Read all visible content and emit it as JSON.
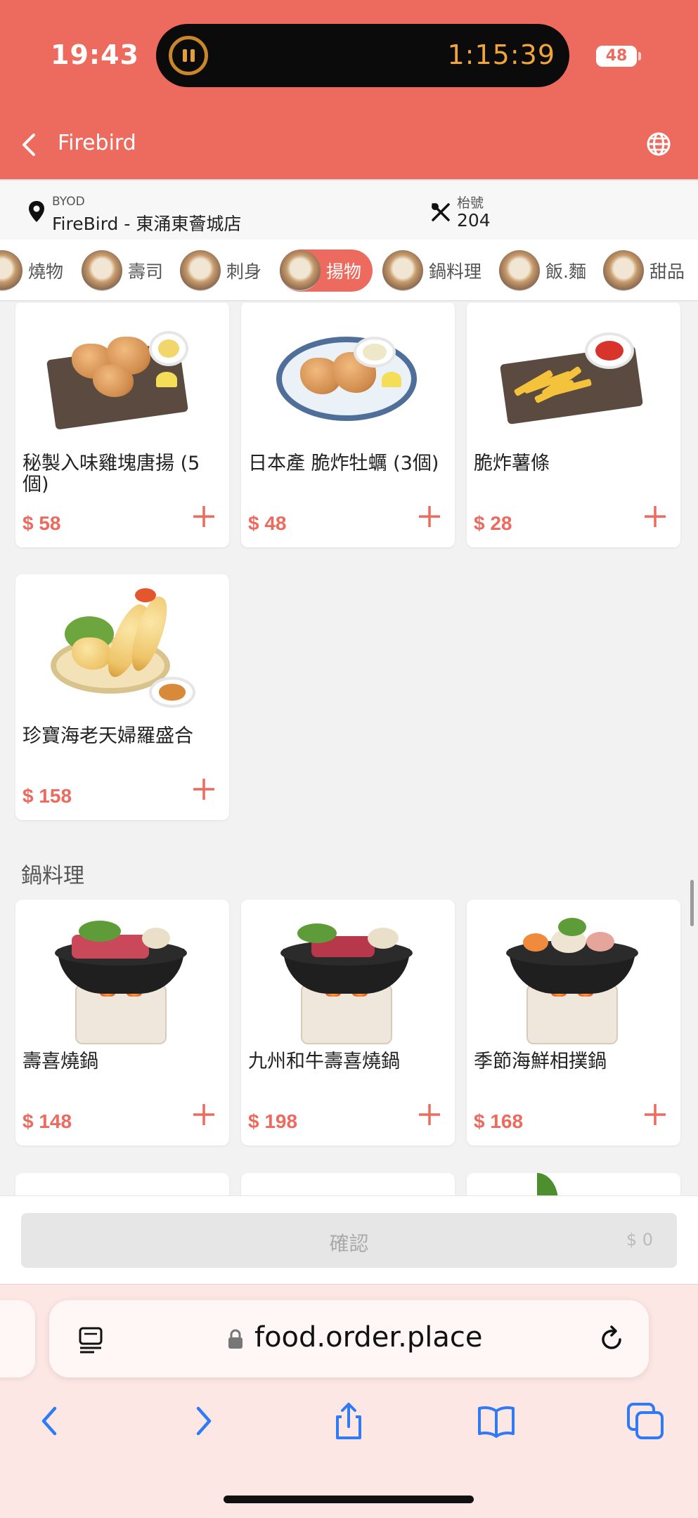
{
  "status_bar": {
    "time": "19:43",
    "timer": "1:15:39",
    "battery": "48"
  },
  "nav": {
    "title": "Firebird",
    "back_icon": "chevron-left-icon",
    "language_icon": "globe-icon"
  },
  "store": {
    "label": "BYOD",
    "name": "FireBird - 東涌東薈城店",
    "table_label": "枱號",
    "table_number": "204"
  },
  "categories": [
    {
      "label": "燒物",
      "active": false
    },
    {
      "label": "壽司",
      "active": false
    },
    {
      "label": "刺身",
      "active": false
    },
    {
      "label": "揚物",
      "active": true
    },
    {
      "label": "鍋料理",
      "active": false
    },
    {
      "label": "飯.麵",
      "active": false
    },
    {
      "label": "甜品",
      "active": false
    }
  ],
  "sections": [
    {
      "title": "",
      "items": [
        {
          "name": "秘製入味雞塊唐揚 (5個)",
          "price": "$ 58"
        },
        {
          "name": "日本產 脆炸牡蠣 (3個)",
          "price": "$ 48"
        },
        {
          "name": "脆炸薯條",
          "price": "$ 28"
        },
        {
          "name": "珍寶海老天婦羅盛合",
          "price": "$ 158"
        }
      ]
    },
    {
      "title": "鍋料理",
      "items": [
        {
          "name": "壽喜燒鍋",
          "price": "$ 148"
        },
        {
          "name": "九州和牛壽喜燒鍋",
          "price": "$ 198"
        },
        {
          "name": "季節海鮮相撲鍋",
          "price": "$ 168"
        }
      ]
    }
  ],
  "confirm": {
    "label": "確認",
    "total": "$ 0"
  },
  "browser": {
    "url": "food.order.place"
  },
  "colors": {
    "brand": "#ec6a5e",
    "browser_bg": "#fde7e4"
  }
}
